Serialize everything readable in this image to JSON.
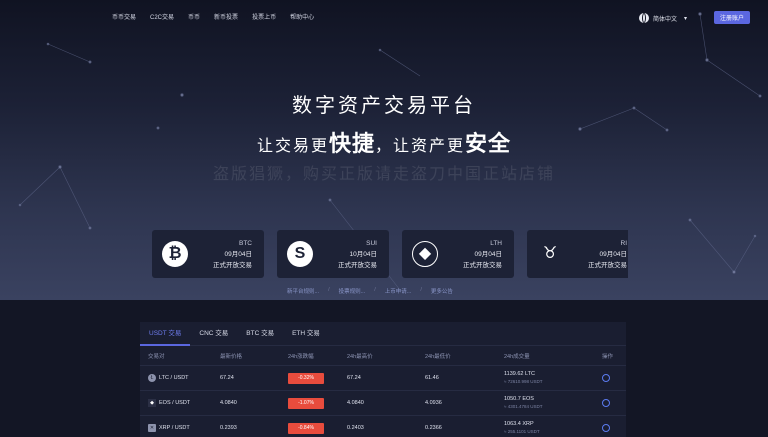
{
  "nav": {
    "items": [
      "币币交易",
      "C2C交易",
      "币币",
      "新币投票",
      "投票上币",
      "帮助中心"
    ]
  },
  "lang": {
    "label": "简体中文"
  },
  "register": {
    "label": "注册账户"
  },
  "hero": {
    "title": "数字资产交易平台",
    "tagline_a": "让交易更",
    "tagline_b": "快捷",
    "tagline_c": "，让资产更",
    "tagline_d": "安全",
    "warning": "盗版猖獗，购买正版请走盗刀中国正站店铺"
  },
  "cards": [
    {
      "symbol": "BTC",
      "date": "09月04日",
      "note": "正式开放交易",
      "icon": "bitcoin-icon",
      "glyph": "₿"
    },
    {
      "symbol": "SUI",
      "date": "10月04日",
      "note": "正式开放交易",
      "icon": "sui-icon",
      "glyph": "S"
    },
    {
      "symbol": "LTH",
      "date": "09月04日",
      "note": "正式开放交易",
      "icon": "ethereum-icon",
      "glyph": "◆"
    },
    {
      "symbol": "RI",
      "date": "09月04日",
      "note": "正式开放交易",
      "icon": "bull-icon",
      "glyph": "♉"
    }
  ],
  "announcements": [
    "新平台规则...",
    "投票规则...",
    "上币申请...",
    "更多公告"
  ],
  "market": {
    "tabs": [
      "USDT 交易",
      "CNC 交易",
      "BTC 交易",
      "ETH 交易"
    ],
    "headers": [
      "交易对",
      "最新价格",
      "24h涨跌幅",
      "24h最高价",
      "24h最低价",
      "24h成交量",
      "操作"
    ],
    "rows": [
      {
        "pair": "LTC / USDT",
        "price": "67.24",
        "change": "-0.32%",
        "high": "67.24",
        "low": "61.46",
        "vol": "1139.62 LTC",
        "vol_sub": "≈ 72610.998 USDT"
      },
      {
        "pair": "EOS / USDT",
        "price": "4.0840",
        "change": "-1.07%",
        "high": "4.0840",
        "low": "4.0936",
        "vol": "1050.7 EOS",
        "vol_sub": "≈ 4301.4784 USDT"
      },
      {
        "pair": "XRP / USDT",
        "price": "0.2393",
        "change": "-0.84%",
        "high": "0.2403",
        "low": "0.2366",
        "vol": "1063.4 XRP",
        "vol_sub": "≈ 255.1101 USDT"
      }
    ]
  },
  "colors": {
    "accent": "#5b67e0",
    "down": "#e84c3d",
    "panel": "#1a1e31"
  }
}
